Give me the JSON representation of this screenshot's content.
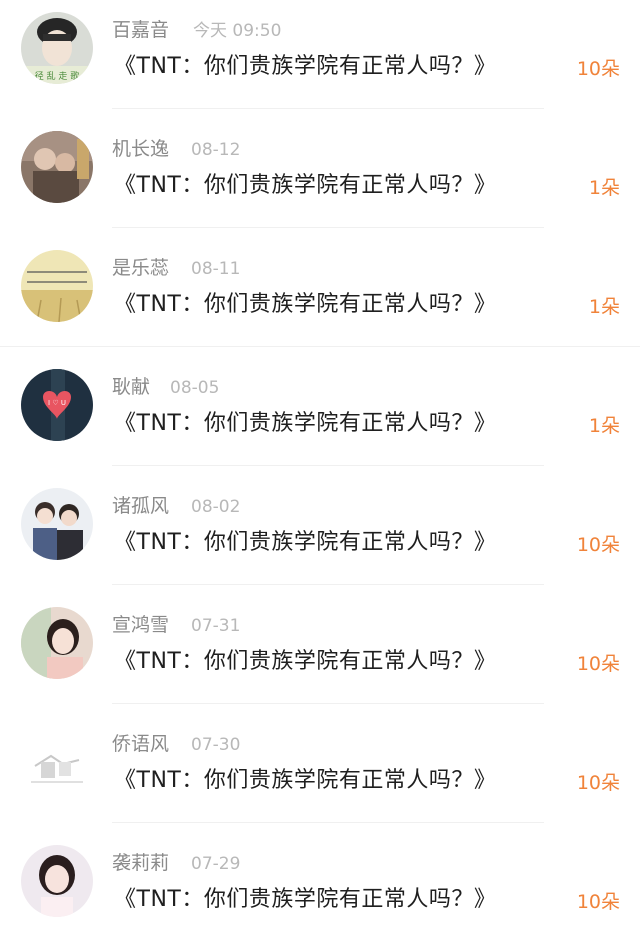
{
  "rows": [
    {
      "name": "百嘉音",
      "time": "今天 09:50",
      "title": "《TNT：你们贵族学院有正常人吗？》",
      "count": "10朵",
      "avatar": "avatar-young-man-icon"
    },
    {
      "name": "机长逸",
      "time": "08-12",
      "title": "《TNT：你们贵族学院有正常人吗？》",
      "count": "1朵",
      "avatar": "avatar-couple-photo-icon"
    },
    {
      "name": "是乐蕊",
      "time": "08-11",
      "title": "《TNT：你们贵族学院有正常人吗？》",
      "count": "1朵",
      "avatar": "avatar-text-field-icon"
    },
    {
      "name": "耿献",
      "time": "08-05",
      "title": "《TNT：你们贵族学院有正常人吗？》",
      "count": "1朵",
      "avatar": "avatar-heart-icon"
    },
    {
      "name": "诸孤风",
      "time": "08-02",
      "title": "《TNT：你们贵族学院有正常人吗？》",
      "count": "10朵",
      "avatar": "avatar-two-girls-icon"
    },
    {
      "name": "宣鸿雪",
      "time": "07-31",
      "title": "《TNT：你们贵族学院有正常人吗？》",
      "count": "10朵",
      "avatar": "avatar-girl-portrait-icon"
    },
    {
      "name": "侨语风",
      "time": "07-30",
      "title": "《TNT：你们贵族学院有正常人吗？》",
      "count": "10朵",
      "avatar": "avatar-sketch-icon"
    },
    {
      "name": "袭莉莉",
      "time": "07-29",
      "title": "《TNT：你们贵族学院有正常人吗？》",
      "count": "10朵",
      "avatar": "avatar-woman-portrait-icon"
    }
  ]
}
